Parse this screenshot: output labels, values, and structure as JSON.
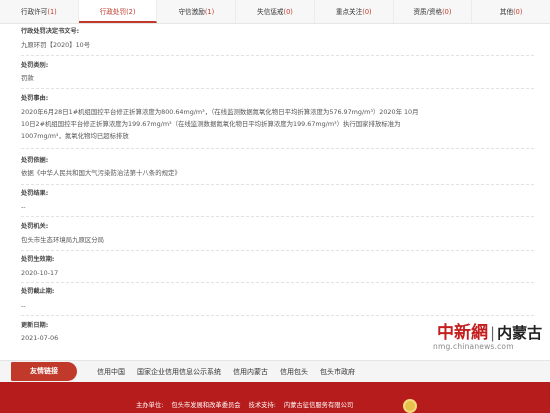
{
  "tabs": [
    {
      "label": "行政许可",
      "count": "(1)",
      "active": false
    },
    {
      "label": "行政处罚",
      "count": "(2)",
      "active": true
    },
    {
      "label": "守信激励",
      "count": "(1)",
      "active": false
    },
    {
      "label": "失信惩戒",
      "count": "(0)",
      "active": false
    },
    {
      "label": "重点关注",
      "count": "(0)",
      "active": false
    },
    {
      "label": "资质/资格",
      "count": "(0)",
      "active": false
    },
    {
      "label": "其他",
      "count": "(0)",
      "active": false
    }
  ],
  "record": {
    "decision_no_label": "行政处罚决定书文号:",
    "decision_no": "九原环罚【2020】10号",
    "type_label": "处罚类别:",
    "type": "罚款",
    "reason_label": "处罚事由:",
    "reason": "2020年6月28日1#机组国控平台修正折算浓度为800.64mg/m³，（在线监测数据氮氧化物日平均折算浓度为576.97mg/m³）2020年 10月10日2#机组国控平台修正折算浓度为199.67mg/m³（在线监测数据氮氧化物日平均折算浓度为199.67mg/m³）执行国家排放标准为1007mg/m³，氮氧化物均已超标排放",
    "basis_label": "处罚依据:",
    "basis": "依据《中华人民共和国大气污染防治法第十八条的规定》",
    "result_label": "处罚结果:",
    "result": "--",
    "authority_label": "处罚机关:",
    "authority": "包头市生态环境局九原区分局",
    "effective_label": "处罚生效期:",
    "effective": "2020-10-17",
    "end_label": "处罚截止期:",
    "end": "--",
    "update_label": "更新日期:",
    "update": "2021-07-06"
  },
  "watermark": {
    "logo": "中新網",
    "region": "内蒙古",
    "url": "nmg.chinanews.com"
  },
  "links": {
    "title": "友情链接",
    "items": [
      "信用中国",
      "国家企业信用信息公示系统",
      "信用内蒙古",
      "信用包头",
      "包头市政府"
    ]
  },
  "footer": {
    "host": "主办单位:",
    "host_name": "包头市发展和改革委员会",
    "support": "技术支持:",
    "support_name": "内蒙古征信服务有限公司"
  },
  "colors": {
    "accent": "#c0392b",
    "footer": "#b71c1c"
  }
}
